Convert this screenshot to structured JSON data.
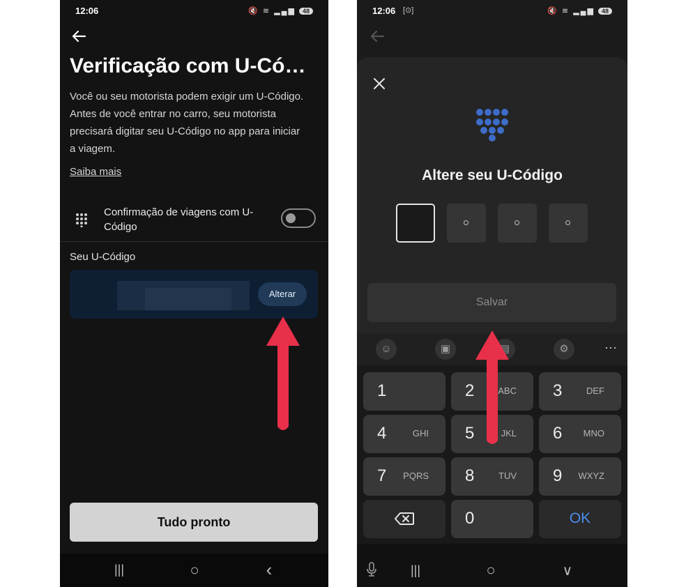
{
  "left": {
    "status": {
      "time": "12:06",
      "battery": "48"
    },
    "header": {
      "back_icon": "arrow-left-icon",
      "title": "Verificação com U-Có…"
    },
    "description": "Você ou seu motorista podem exigir um U-Código. Antes de você entrar no carro, seu motorista precisará digitar seu U-Código no app para iniciar a viagem.",
    "learn_more": "Saiba mais",
    "toggle_row": {
      "icon": "keypad-icon",
      "label": "Confirmação de viagens com U-Código",
      "enabled": false
    },
    "code_section": {
      "label": "Seu U-Código",
      "change_button": "Alterar"
    },
    "done_button": "Tudo pronto",
    "nav": {
      "recents": "|||",
      "home": "○",
      "back": "‹"
    }
  },
  "right": {
    "status": {
      "time": "12:06",
      "battery": "48"
    },
    "modal": {
      "close_icon": "close-icon",
      "keypad_icon_color": "#3e6dc8",
      "title": "Altere seu U-Código",
      "digit_count": 4,
      "save_button": "Salvar"
    },
    "keyboard_toolbar": {
      "tools": [
        "emoji-icon",
        "sticker-icon",
        "clipboard-icon",
        "settings-icon"
      ],
      "more": "···"
    },
    "keys": [
      {
        "num": "1",
        "letters": ""
      },
      {
        "num": "2",
        "letters": "ABC"
      },
      {
        "num": "3",
        "letters": "DEF"
      },
      {
        "num": "4",
        "letters": "GHI"
      },
      {
        "num": "5",
        "letters": "JKL"
      },
      {
        "num": "6",
        "letters": "MNO"
      },
      {
        "num": "7",
        "letters": "PQRS"
      },
      {
        "num": "8",
        "letters": "TUV"
      },
      {
        "num": "9",
        "letters": "WXYZ"
      },
      {
        "num": "0",
        "letters": ""
      }
    ],
    "ok_key": "OK",
    "nav": {
      "recents": "|||",
      "home": "○",
      "hide": "∨"
    }
  },
  "colors": {
    "arrow": "#e8304a",
    "link_accent": "#4a8df0"
  }
}
